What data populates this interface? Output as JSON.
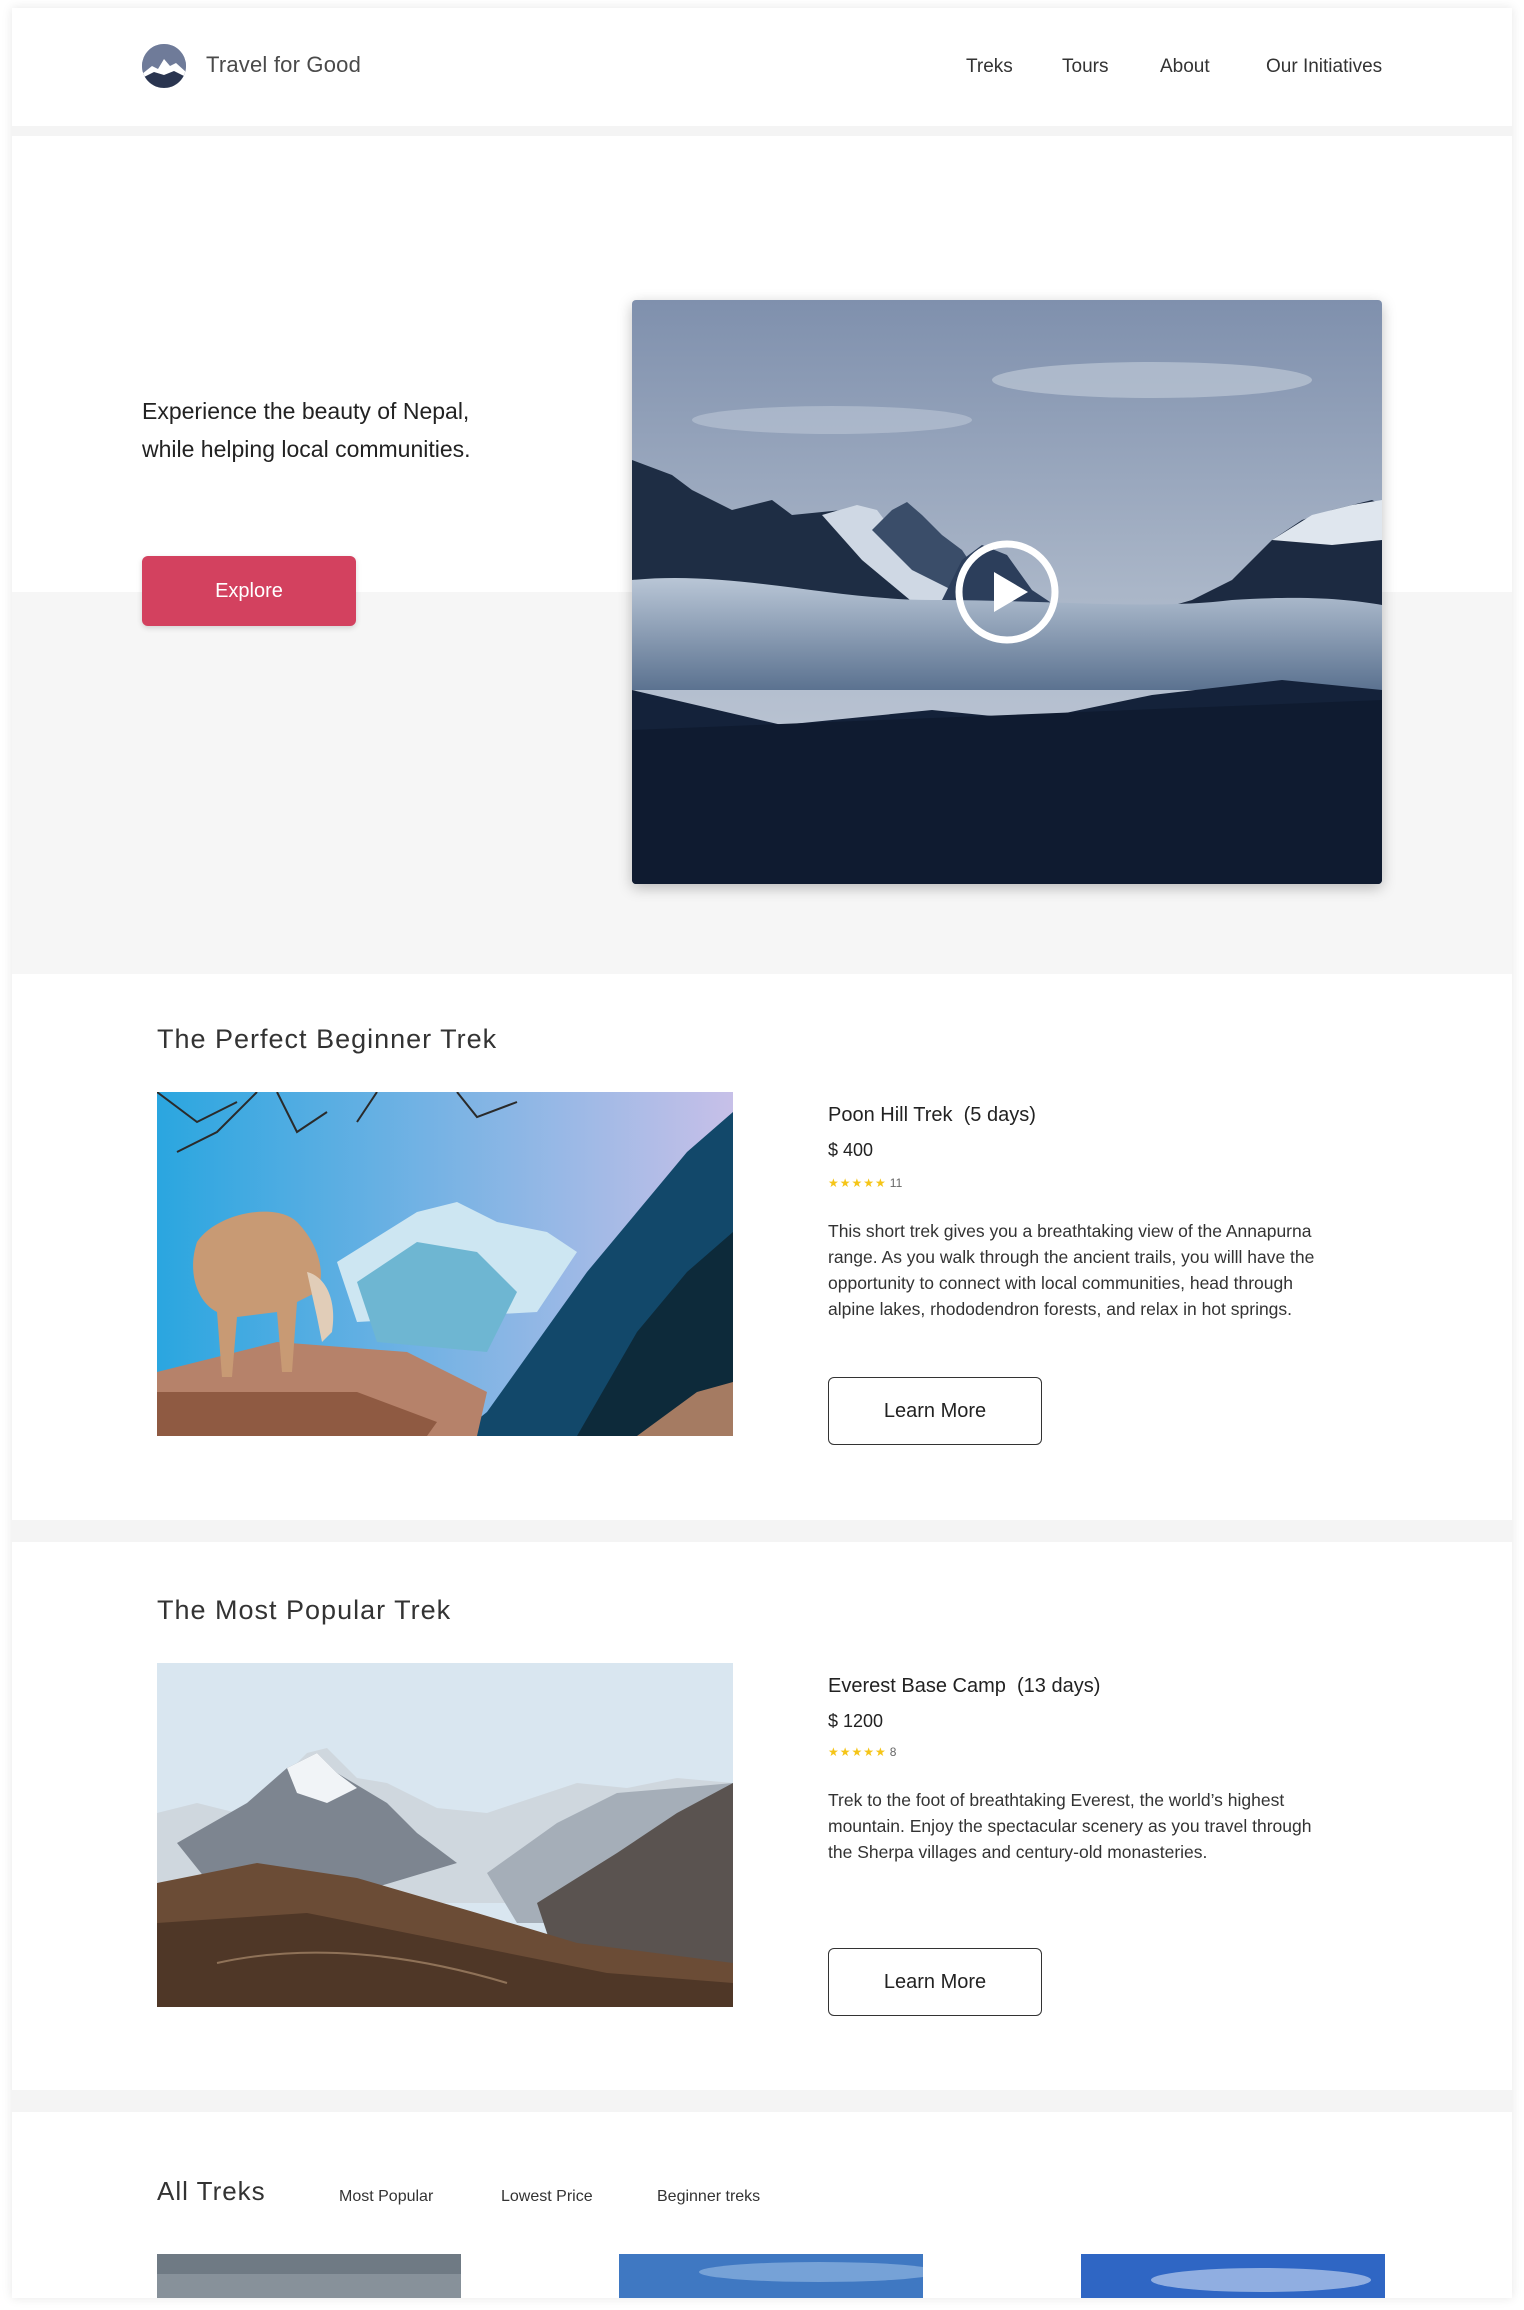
{
  "header": {
    "brand": "Travel for Good",
    "nav": [
      "Treks",
      "Tours",
      "About",
      "Our Initiatives"
    ]
  },
  "hero": {
    "tagline_line1": "Experience the beauty of Nepal,",
    "tagline_line2": "while helping local communities.",
    "cta_label": "Explore",
    "accent_color": "#d3415f"
  },
  "beginner": {
    "section_title": "The Perfect Beginner Trek",
    "name": "Poon Hill Trek",
    "duration": "(5 days)",
    "price": "$ 400",
    "stars": "★★★★★",
    "review_count": "11",
    "description": "This short trek gives you a breathtaking view of the Annapurna range. As you walk through the ancient trails, you willl have the opportunity to connect with local communities, head through alpine lakes, rhododendron forests, and relax in hot springs.",
    "button_label": "Learn More"
  },
  "popular": {
    "section_title": "The Most Popular Trek",
    "name": "Everest Base Camp",
    "duration": "(13 days)",
    "price": "$ 1200",
    "stars": "★★★★★",
    "review_count": "8",
    "description": "Trek to the foot of breathtaking Everest, the world’s highest mountain. Enjoy the spectacular scenery as you travel through the Sherpa villages and century-old monasteries.",
    "button_label": "Learn More"
  },
  "all_treks": {
    "title": "All Treks",
    "filters": [
      "Most Popular",
      "Lowest Price",
      "Beginner treks"
    ]
  },
  "icons": {
    "logo": "mountain-logo-icon",
    "play": "play-icon"
  }
}
